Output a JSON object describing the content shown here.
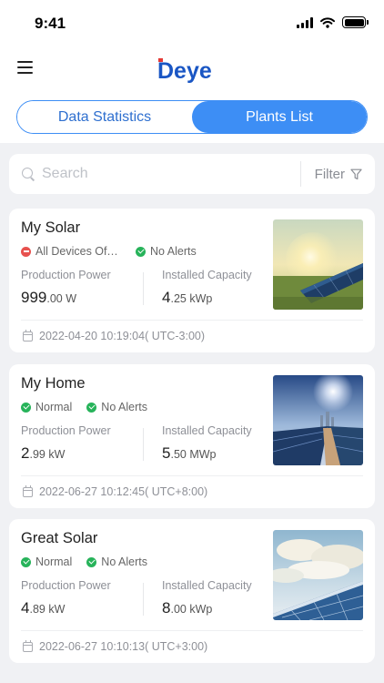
{
  "status_bar": {
    "time": "9:41"
  },
  "header": {
    "brand": "Deye",
    "tabs": [
      {
        "label": "Data Statistics",
        "active": false
      },
      {
        "label": "Plants List",
        "active": true
      }
    ]
  },
  "search": {
    "placeholder": "Search",
    "filter_label": "Filter"
  },
  "labels": {
    "production_power": "Production Power",
    "installed_capacity": "Installed Capacity"
  },
  "plants": [
    {
      "name": "My Solar",
      "device_status": "All Devices Offline",
      "device_status_type": "error",
      "alert_status": "No Alerts",
      "power_int": "999",
      "power_dec": ".00",
      "power_unit": "W",
      "capacity_int": "4",
      "capacity_dec": ".25",
      "capacity_unit": "kWp",
      "date": "2022-04-20 10:19:04( UTC-3:00)",
      "image": "sunset-field-panels"
    },
    {
      "name": "My Home",
      "device_status": "Normal",
      "device_status_type": "ok",
      "alert_status": "No Alerts",
      "power_int": "2",
      "power_dec": ".99",
      "power_unit": "kW",
      "capacity_int": "5",
      "capacity_dec": ".50",
      "capacity_unit": "MWp",
      "date": "2022-06-27 10:12:45( UTC+8:00)",
      "image": "sunrise-panel-rows"
    },
    {
      "name": "Great Solar",
      "device_status": "Normal",
      "device_status_type": "ok",
      "alert_status": "No Alerts",
      "power_int": "4",
      "power_dec": ".89",
      "power_unit": "kW",
      "capacity_int": "8",
      "capacity_dec": ".00",
      "capacity_unit": "kWp",
      "date": "2022-06-27 10:10:13( UTC+3:00)",
      "image": "sky-clouds-panel"
    }
  ],
  "colors": {
    "accent": "#3d8ef5",
    "brand": "#1a56c4",
    "ok": "#27b35a",
    "error": "#e7514e"
  }
}
